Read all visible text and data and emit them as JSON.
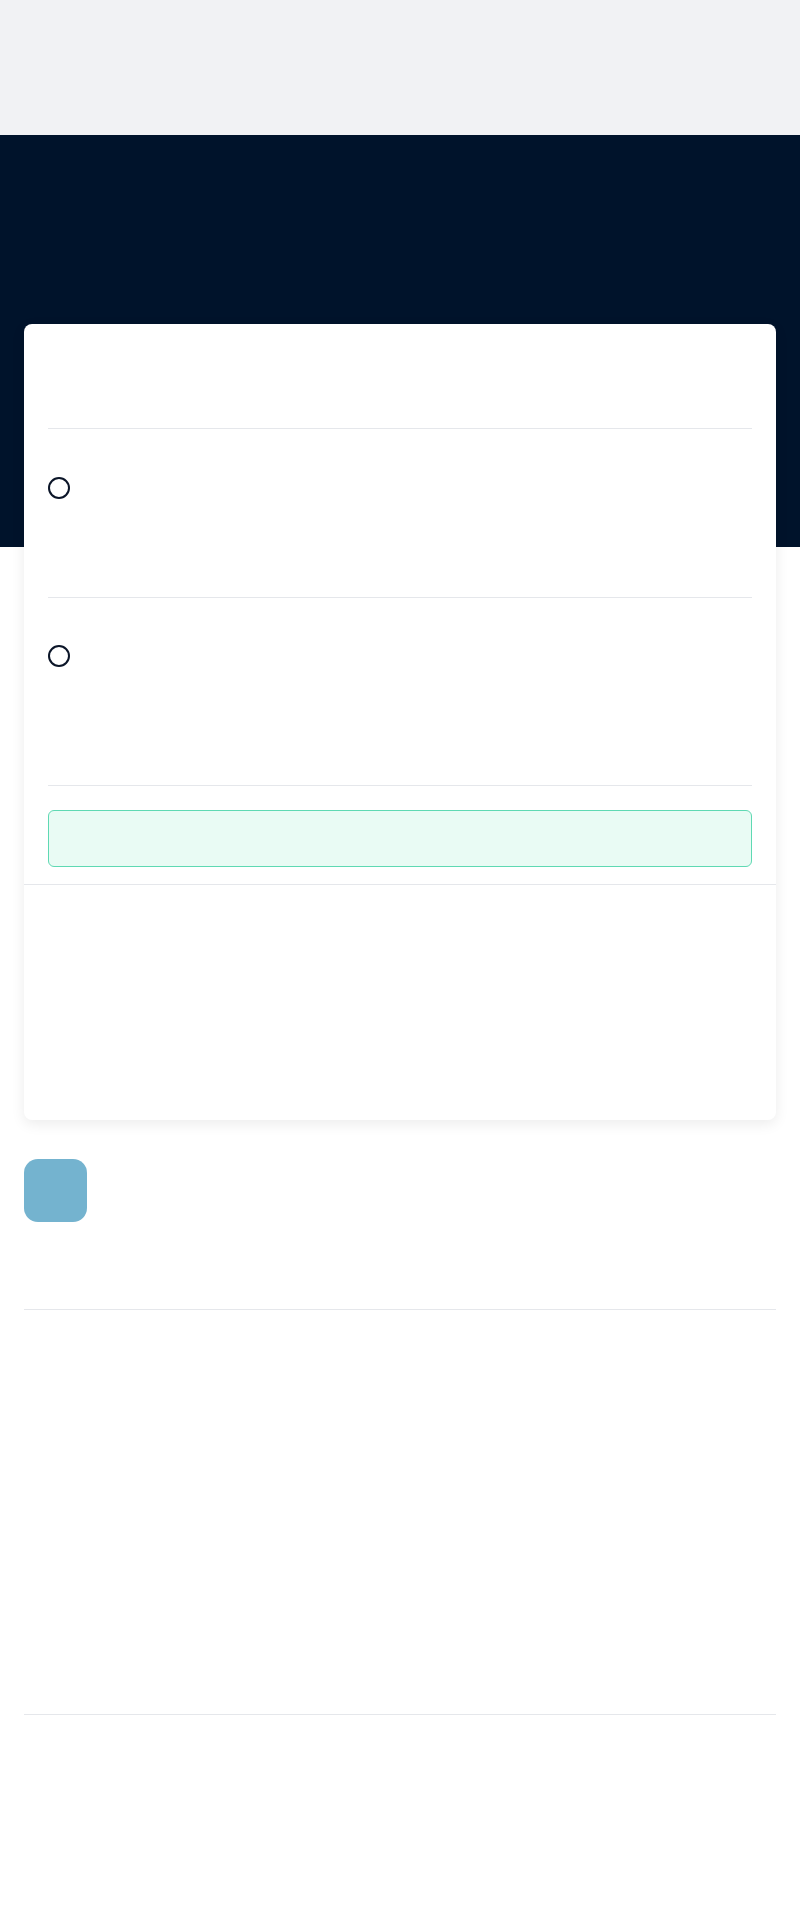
{
  "options": [
    {
      "selected": false
    },
    {
      "selected": false
    }
  ],
  "notice": {
    "kind": "success"
  }
}
